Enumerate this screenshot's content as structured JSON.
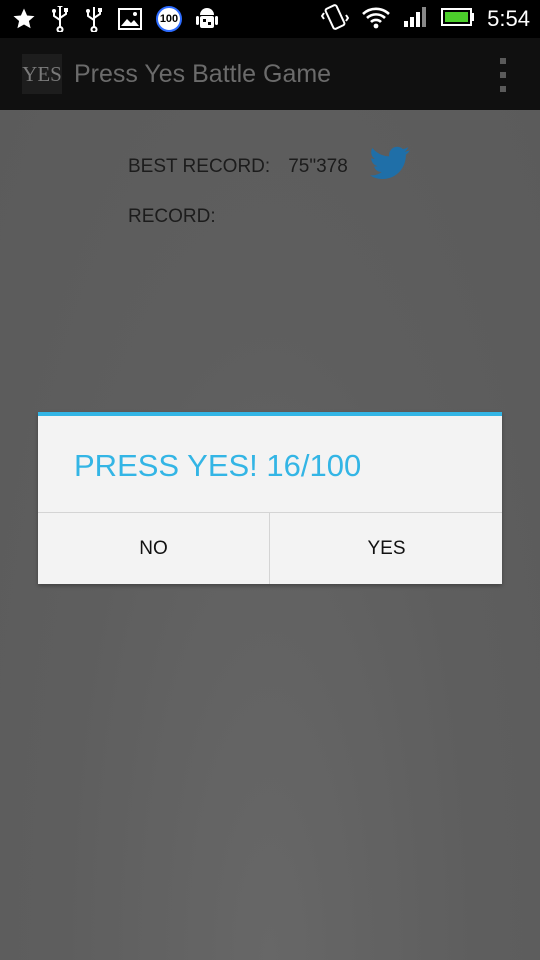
{
  "status_bar": {
    "time": "5:54",
    "battery_badge": "100",
    "icons_left": [
      "star-icon",
      "usb-icon",
      "usb-icon",
      "image-icon",
      "battery-100-badge",
      "android-debug-icon"
    ],
    "icons_right": [
      "vibrate-icon",
      "wifi-icon",
      "signal-icon",
      "battery-icon"
    ]
  },
  "action_bar": {
    "app_icon_text": "YES",
    "title": "Press Yes Battle Game",
    "overflow_icon": "overflow-menu-icon"
  },
  "main": {
    "best_record_label": "BEST RECORD:",
    "best_record_value": "75\"378",
    "record_label": "RECORD:",
    "share_icon": "twitter-icon",
    "twitter_color": "#1f6fa8"
  },
  "dialog": {
    "title": "PRESS YES! 16/100",
    "no_label": "NO",
    "yes_label": "YES",
    "accent_color": "#33b5e5"
  }
}
